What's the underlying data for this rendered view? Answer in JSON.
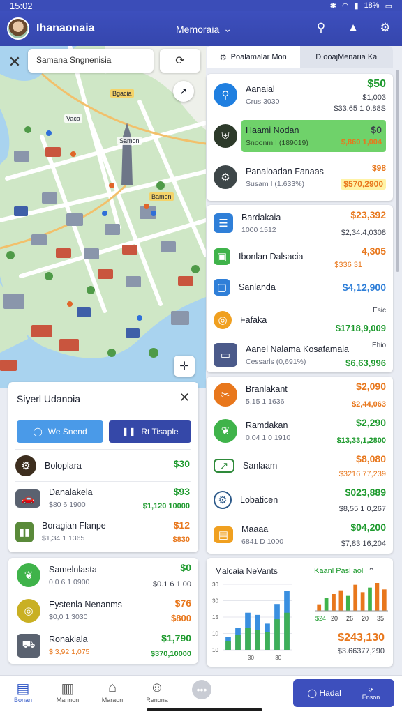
{
  "status": {
    "time": "15:02",
    "battery": "18%"
  },
  "app": {
    "title": "Ihanaonaia",
    "menu_label": "Memoraia"
  },
  "map": {
    "search_placeholder": "Samana Sngnenisia",
    "labels": [
      "Bgacia",
      "Samon",
      "Bamon",
      "Vaca"
    ]
  },
  "tabs": [
    {
      "label": "Poalamalar Mon"
    },
    {
      "label": "D ooajMenaria Ka"
    }
  ],
  "featured": [
    {
      "title": "Aanaial",
      "sub": "Crus 3030",
      "value": "$50",
      "value2": "$1,003",
      "value3": "$33.65 1 0.88S",
      "icon": "pin-icon",
      "color": "#1f7fe0"
    },
    {
      "title": "Haami Nodan",
      "sub": "Snoonm I (189019)",
      "value": "$0",
      "value2": "$,860 1,004",
      "icon": "shield-icon",
      "color": "#2d3a2a"
    },
    {
      "title": "Panaloadan Fanaas",
      "sub": "Susam I (1.633%)",
      "value": "$98",
      "value2": "$570,2900",
      "icon": "gear-icon",
      "color": "#3d4648"
    }
  ],
  "transactions": [
    {
      "title": "Bardakaia",
      "sub": "1000 1512",
      "value": "$23,392",
      "value2": "$2,34.4,0308",
      "icon": "document-icon",
      "tone": "orange"
    },
    {
      "title": "Ibonlan Dalsacia",
      "sub": "",
      "value": "4,305",
      "value2": "$336 31",
      "icon": "wallet-icon",
      "tone": "orange"
    },
    {
      "title": "Sanlanda",
      "sub": "",
      "value": "$4,12,900",
      "value2": "",
      "icon": "square-icon",
      "tone": "blue"
    },
    {
      "title": "Fafaka",
      "sub": "",
      "value": "Esic",
      "value2": "$1718,9,009",
      "icon": "coin-icon",
      "tone": "green"
    },
    {
      "title": "Aanel Nalama Kosafamaia",
      "sub": "Cessarls (0,691%)",
      "value": "Ehio",
      "value2": "$6,63,996",
      "icon": "monitor-icon",
      "tone": "green"
    },
    {
      "title": "Branlakant",
      "sub": "5,15 1 1636",
      "value": "$2,090",
      "value2": "$2,44,063",
      "icon": "tools-icon",
      "tone": "orange"
    },
    {
      "title": "Ramdakan",
      "sub": "0,04 1 0 1910",
      "value": "$2,290",
      "value2": "$13,33,1,2800",
      "icon": "leaf-icon",
      "tone": "green"
    },
    {
      "title": "Sanlaam",
      "sub": "",
      "value": "$8,080",
      "value2": "$3216 77,239",
      "icon": "chart-icon",
      "tone": "orange"
    },
    {
      "title": "Lobaticen",
      "sub": "",
      "value": "$023,889",
      "value2": "$8,55 1 0,267",
      "icon": "gears-icon",
      "tone": "green"
    },
    {
      "title": "Maaaa",
      "sub": "6841 D 1000",
      "value": "$04,200",
      "value2": "$7,83 16,204",
      "icon": "cash-register-icon",
      "tone": "green"
    }
  ],
  "popup": {
    "title": "Siyerl Udanoia",
    "btn_primary": "We Snend",
    "btn_secondary": "Rt Tisaple",
    "items": [
      {
        "title": "Boloplara",
        "sub": "",
        "value": "$30",
        "value2": "",
        "icon": "engine-icon",
        "tone": "green"
      },
      {
        "title": "Danalakela",
        "sub": "$80 6 1900",
        "value": "$93",
        "value2": "$1,120 10000",
        "icon": "car-icon",
        "tone": "green"
      },
      {
        "title": "Boragian Flanpe",
        "sub": "$1,34 1 1365",
        "value": "$12",
        "value2": "$830",
        "icon": "battery-icon",
        "tone": "orange"
      }
    ]
  },
  "lower_list": [
    {
      "title": "Samelnlasta",
      "sub": "0,0 6 1 0900",
      "value": "$0",
      "value2": "$0.1 6 1 00",
      "icon": "leaf-icon",
      "tone": "green"
    },
    {
      "title": "Eystenla Nenanms",
      "sub": "$0,0 1 3030",
      "value": "$76",
      "value2": "$800",
      "icon": "coin-icon",
      "tone": "orange"
    },
    {
      "title": "Ronakiala",
      "sub": "$ 3,92 1,075",
      "value": "$1,790",
      "value2": "$370,10000",
      "icon": "truck-icon",
      "tone": "green"
    }
  ],
  "charts": {
    "left_title": "Malcaia NeVants",
    "right_title": "Kaanl Pasl aol",
    "summary_value": "$243,130",
    "summary_sub": "$3.66377,290"
  },
  "chart_data": [
    {
      "type": "bar",
      "title": "Malcaia NeVants",
      "categories": [
        "1",
        "2",
        "3",
        "4",
        "5",
        "6",
        "7"
      ],
      "series": [
        {
          "values": [
            6,
            10,
            17,
            16,
            12,
            21,
            27
          ]
        },
        {
          "values": [
            4,
            7,
            10,
            9,
            8,
            14,
            17
          ]
        }
      ],
      "ytick_labels": [
        "30",
        "30",
        "15",
        "10",
        "10"
      ],
      "xtick_labels": [
        "30",
        "30"
      ],
      "colors": [
        "#3a8fe0",
        "#3fb34a"
      ]
    },
    {
      "type": "bar",
      "title": "Kaanl Pasl aol",
      "categories": [
        "1",
        "2",
        "3",
        "4",
        "5",
        "6",
        "7",
        "8",
        "9",
        "10"
      ],
      "series": [
        {
          "values": [
            7,
            14,
            18,
            22,
            16,
            28,
            20,
            25,
            30,
            23
          ]
        }
      ],
      "xtick_labels": [
        "$24",
        "20",
        "26",
        "20",
        "35"
      ],
      "colors": [
        "#e8771c",
        "#3fb34a"
      ]
    }
  ],
  "nav": [
    {
      "label": "Bonan",
      "icon": "home-icon",
      "active": true
    },
    {
      "label": "Mannon",
      "icon": "building-icon",
      "active": false
    },
    {
      "label": "Maraon",
      "icon": "bag-icon",
      "active": false
    },
    {
      "label": "Renona",
      "icon": "person-icon",
      "active": false
    },
    {
      "label": "",
      "icon": "more-icon",
      "active": false
    }
  ],
  "nav_action": {
    "label": "Hadal",
    "sub": "Enson"
  },
  "colors": {
    "primary": "#3d4fbd",
    "green": "#1e9a2e",
    "orange": "#e8771c",
    "blue": "#2f7fd8",
    "highlight": "#6fd26a"
  }
}
